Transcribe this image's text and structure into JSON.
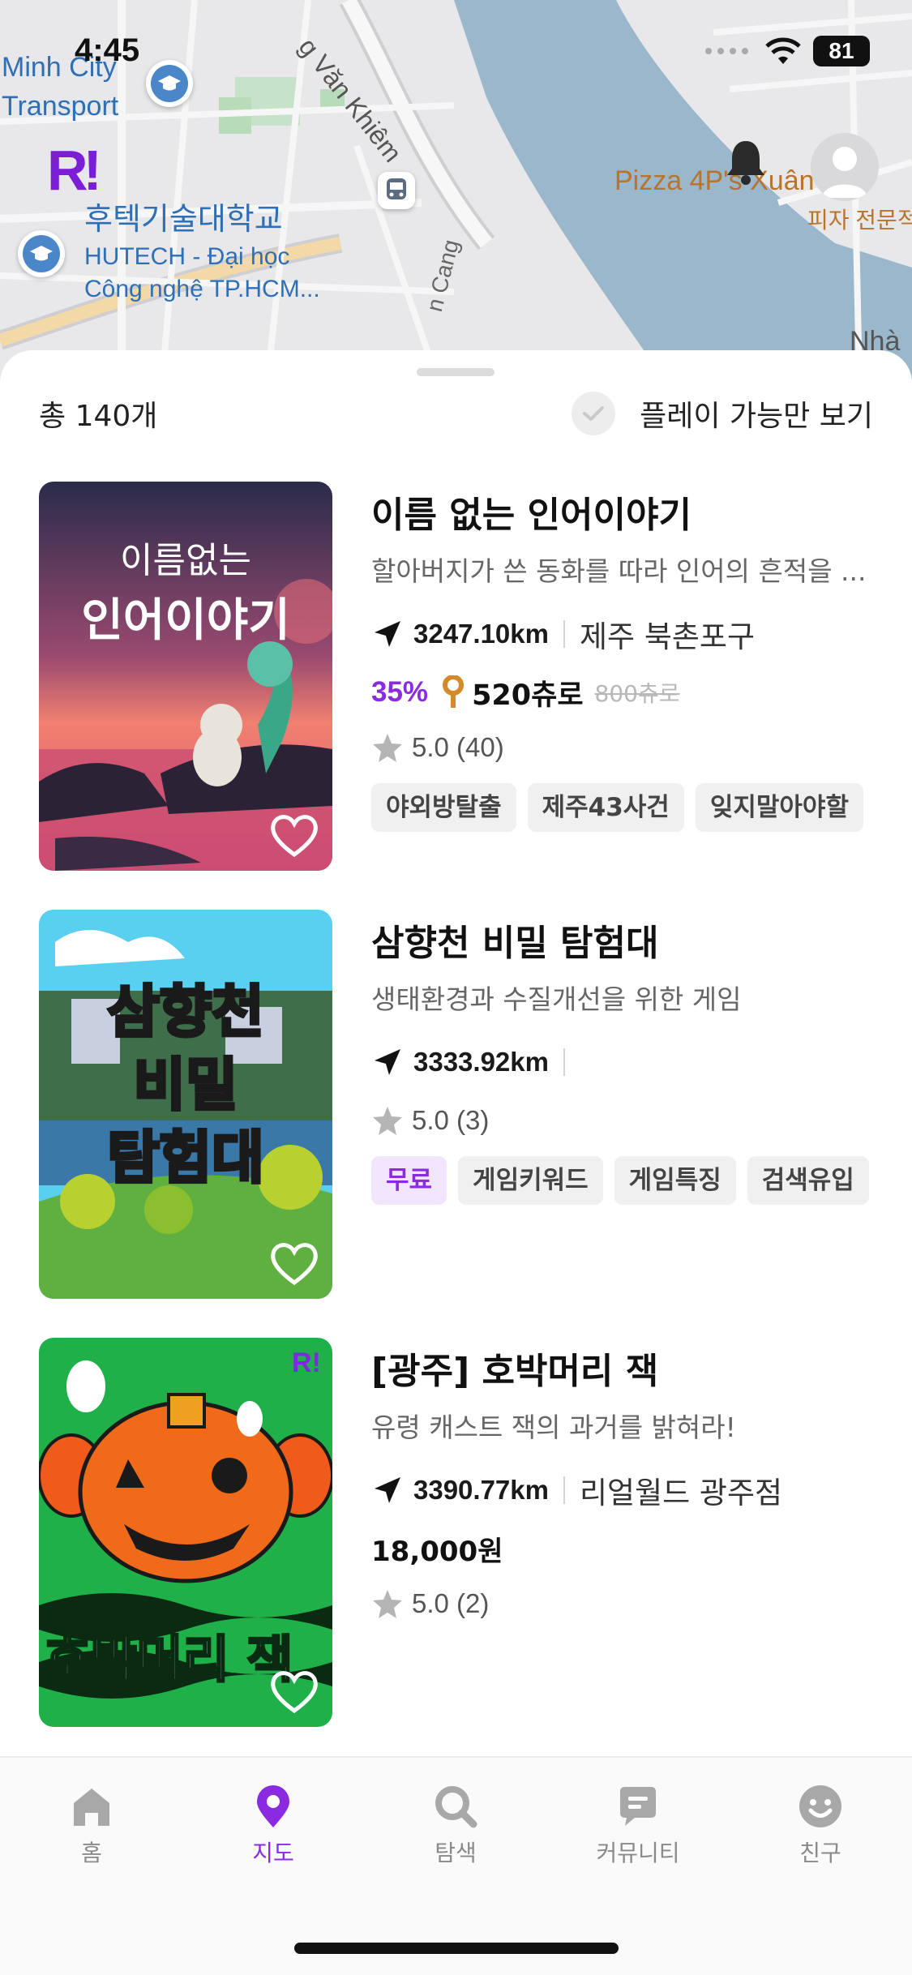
{
  "status_bar": {
    "time": "4:45",
    "battery": "81"
  },
  "map": {
    "labels": {
      "minh_city": "Minh City",
      "transport": "Transport",
      "van_khiem": "g Văn Khiêm",
      "school_ko": "후텍기술대학교",
      "school_vi1": "HUTECH - Đại học",
      "school_vi2": "Công nghệ TP.HCM...",
      "pizza": "Pizza 4P's Xuân hu",
      "pizza_ko": "피자 전문적",
      "road": "n Cang",
      "nha": "Nhà"
    },
    "brand": "R!"
  },
  "list": {
    "total": "총 140개",
    "filter_label": "플레이 가능만 보기",
    "items": [
      {
        "title": "이름 없는 인어이야기",
        "desc": "할아버지가 쓴 동화를 따라 인어의 흔적을 ...",
        "distance": "3247.10km",
        "place": "제주 북촌포구",
        "discount": "35%",
        "price": "520츄로",
        "old_price": "800츄로",
        "rating": "5.0 (40)",
        "tags": [
          "야외방탈출",
          "제주43사건",
          "잊지말아야할"
        ],
        "thumb_text": [
          "이름없는",
          "인어이야기"
        ]
      },
      {
        "title": "삼향천 비밀 탐험대",
        "desc": "생태환경과 수질개선을 위한 게임",
        "distance": "3333.92km",
        "rating": "5.0 (3)",
        "tags": [
          "무료",
          "게임키워드",
          "게임특징",
          "검색유입"
        ],
        "thumb_text": [
          "삼향천",
          "비밀",
          "탐험대"
        ]
      },
      {
        "title": "[광주] 호박머리 잭",
        "desc": "유령 캐스트 잭의 과거를 밝혀라!",
        "distance": "3390.77km",
        "place": "리얼월드 광주점",
        "price_won": "18,000원",
        "rating": "5.0 (2)",
        "thumb_text": [
          "호박머리 잭"
        ],
        "thumb_brand": "R!"
      }
    ]
  },
  "tabs": [
    {
      "label": "홈",
      "icon": "home-icon"
    },
    {
      "label": "지도",
      "icon": "map-pin-icon",
      "active": true
    },
    {
      "label": "탐색",
      "icon": "search-icon"
    },
    {
      "label": "커뮤니티",
      "icon": "chat-icon"
    },
    {
      "label": "친구",
      "icon": "smile-icon"
    }
  ],
  "colors": {
    "accent": "#8a2be2",
    "map_water": "#9ab7cc",
    "map_land": "#e8e8ea"
  }
}
